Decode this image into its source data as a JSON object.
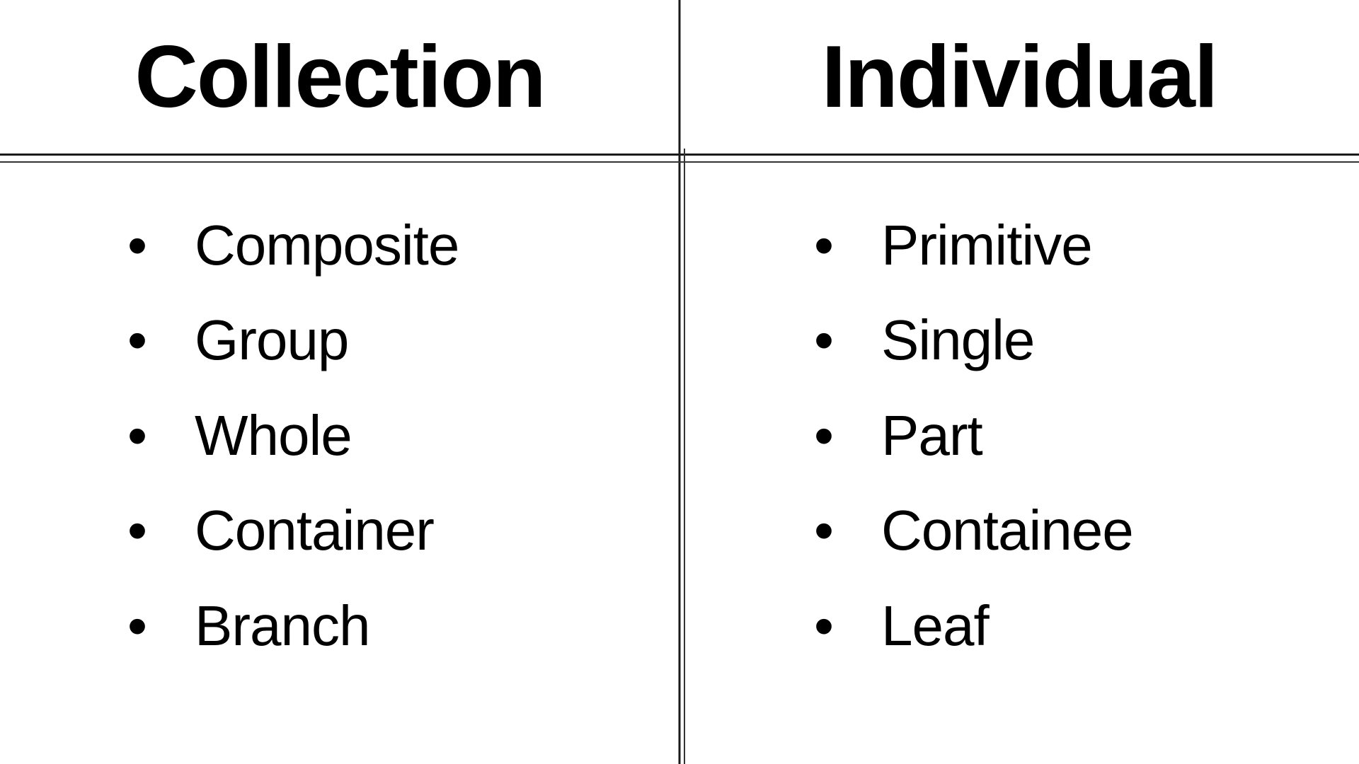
{
  "chart_data": {
    "type": "table",
    "columns": [
      "Collection",
      "Individual"
    ],
    "rows": [
      [
        "Composite",
        "Primitive"
      ],
      [
        "Group",
        "Single"
      ],
      [
        "Whole",
        "Part"
      ],
      [
        "Container",
        "Containee"
      ],
      [
        "Branch",
        "Leaf"
      ]
    ]
  },
  "left": {
    "heading": "Collection",
    "items": [
      "Composite",
      "Group",
      "Whole",
      "Container",
      "Branch"
    ]
  },
  "right": {
    "heading": "Individual",
    "items": [
      "Primitive",
      "Single",
      "Part",
      "Containee",
      "Leaf"
    ]
  }
}
